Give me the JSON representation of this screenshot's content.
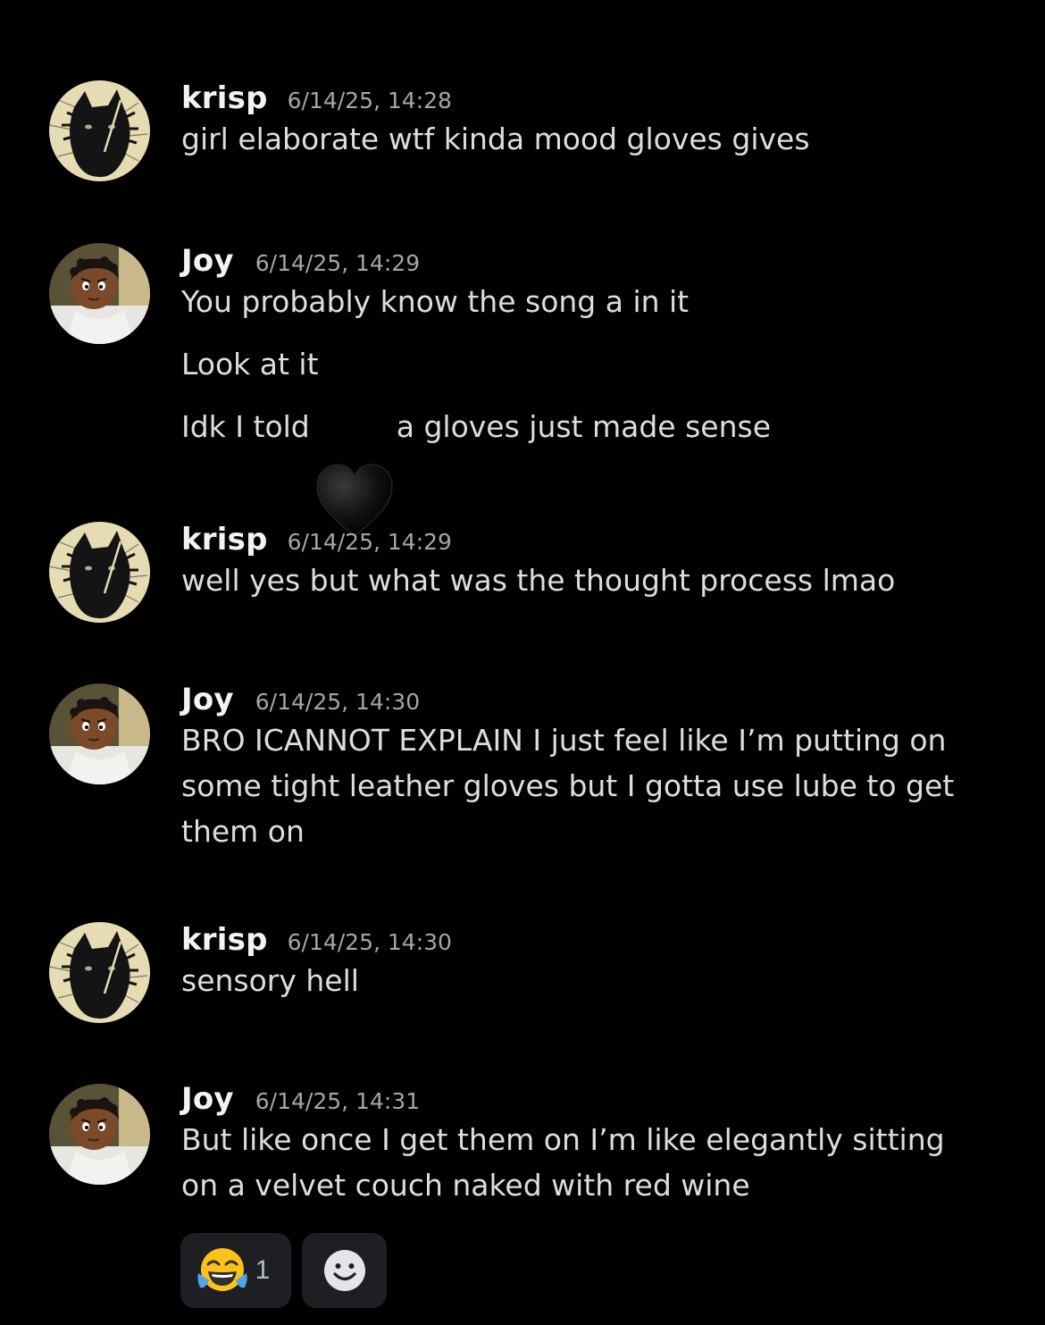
{
  "colors": {
    "background": "#000000",
    "username": "#f2f3f5",
    "timestamp": "#a3a6aa",
    "message_text": "#dbdee1",
    "reaction_bg": "#1e1f22"
  },
  "messages": [
    {
      "author": "krisp",
      "avatar": "cat-avatar",
      "timestamp": "6/14/25, 14:28",
      "lines": [
        "girl elaborate wtf kinda mood gloves gives"
      ]
    },
    {
      "author": "Joy",
      "avatar": "boy-avatar",
      "timestamp": "6/14/25, 14:29",
      "lines": [
        "You probably know the song a in it",
        "Look at it",
        "Idk I told",
        "a gloves just made sense"
      ]
    },
    {
      "author": "krisp",
      "avatar": "cat-avatar",
      "timestamp": "6/14/25, 14:29",
      "lines": [
        "well yes but what was the thought process lmao"
      ]
    },
    {
      "author": "Joy",
      "avatar": "boy-avatar",
      "timestamp": "6/14/25, 14:30",
      "lines": [
        "BRO ICANNOT EXPLAIN I just feel like I’m putting on some tight leather gloves but I gotta use lube to get them on"
      ]
    },
    {
      "author": "krisp",
      "avatar": "cat-avatar",
      "timestamp": "6/14/25, 14:30",
      "lines": [
        "sensory hell"
      ]
    },
    {
      "author": "Joy",
      "avatar": "boy-avatar",
      "timestamp": "6/14/25, 14:31",
      "lines": [
        "But like once I get them on I’m like elegantly sitting on a velvet couch naked with red wine"
      ]
    }
  ],
  "overlay": {
    "icon": "black-heart-icon"
  },
  "reactions": [
    {
      "emoji": "😂",
      "icon": "tears-of-joy-emoji-icon",
      "count": "1"
    },
    {
      "icon": "add-reaction-smiley-icon"
    }
  ]
}
